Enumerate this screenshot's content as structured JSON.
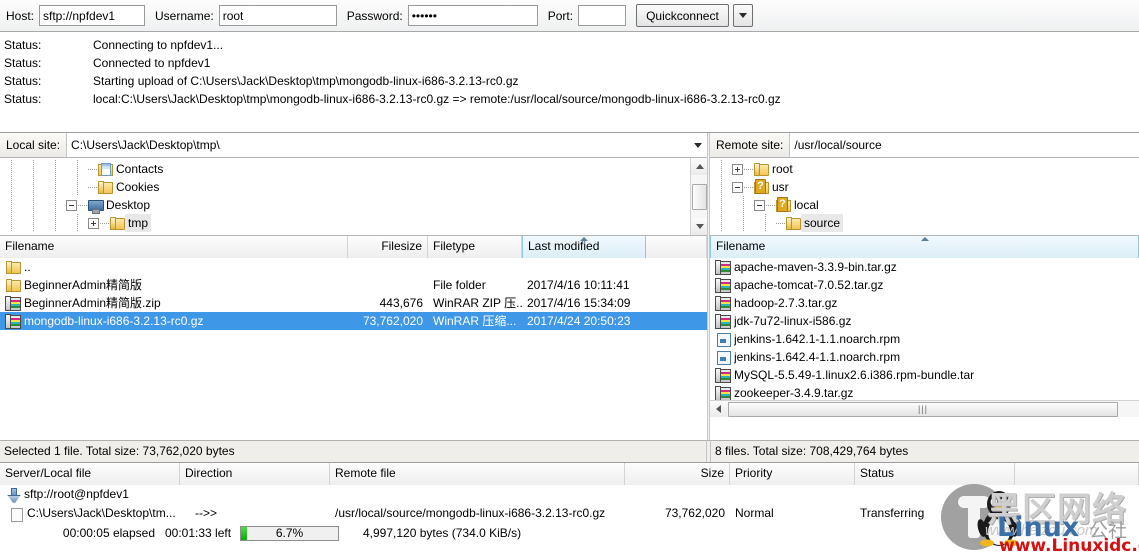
{
  "quickconnect": {
    "host_label": "Host:",
    "host_value": "sftp://npfdev1",
    "user_label": "Username:",
    "user_value": "root",
    "pass_label": "Password:",
    "pass_value": "••••••",
    "port_label": "Port:",
    "port_value": "",
    "port_placeholder": "",
    "connect_label": "Quickconnect",
    "dropdown_icon": "chevron-down-icon"
  },
  "log": {
    "key": "Status:",
    "messages": [
      "Connecting to npfdev1...",
      "Connected to npfdev1",
      "Starting upload of C:\\Users\\Jack\\Desktop\\tmp\\mongodb-linux-i686-3.2.13-rc0.gz",
      "local:C:\\Users\\Jack\\Desktop\\tmp\\mongodb-linux-i686-3.2.13-rc0.gz => remote:/usr/local/source/mongodb-linux-i686-3.2.13-rc0.gz"
    ]
  },
  "local_pane": {
    "site_label": "Local site:",
    "site_path": "C:\\Users\\Jack\\Desktop\\tmp\\",
    "tree": [
      {
        "label": "Contacts",
        "depth": 4,
        "expander": "none",
        "icon": "folder-contacts-icon",
        "selected": false
      },
      {
        "label": "Cookies",
        "depth": 4,
        "expander": "none",
        "icon": "folder-icon",
        "selected": false
      },
      {
        "label": "Desktop",
        "depth": 3,
        "expander": "minus",
        "icon": "desktop-icon",
        "selected": false
      },
      {
        "label": "tmp",
        "depth": 4,
        "expander": "plus",
        "icon": "folder-icon",
        "selected": true
      }
    ],
    "columns": [
      "Filename",
      "Filesize",
      "Filetype",
      "Last modified"
    ],
    "sorted_column": "Last modified",
    "sort_direction": "asc",
    "files": [
      {
        "name": "..",
        "size": "",
        "type": "",
        "modified": "",
        "icon": "folder-up-icon",
        "selected": false
      },
      {
        "name": "BeginnerAdmin精简版",
        "size": "",
        "type": "File folder",
        "modified": "2017/4/16 10:11:41",
        "icon": "folder-icon",
        "selected": false
      },
      {
        "name": "BeginnerAdmin精简版.zip",
        "size": "443,676",
        "type": "WinRAR ZIP 压...",
        "modified": "2017/4/16 15:34:09",
        "icon": "archive-icon",
        "selected": false
      },
      {
        "name": "mongodb-linux-i686-3.2.13-rc0.gz",
        "size": "73,762,020",
        "type": "WinRAR 压缩...",
        "modified": "2017/4/24 20:50:23",
        "icon": "archive-icon",
        "selected": true
      }
    ],
    "status": "Selected 1 file. Total size: 73,762,020 bytes"
  },
  "remote_pane": {
    "site_label": "Remote site:",
    "site_path": "/usr/local/source",
    "tree": [
      {
        "label": "root",
        "depth": 1,
        "expander": "plus",
        "icon": "folder-icon",
        "selected": false
      },
      {
        "label": "usr",
        "depth": 1,
        "expander": "minus",
        "icon": "folder-unknown-icon",
        "selected": false
      },
      {
        "label": "local",
        "depth": 2,
        "expander": "minus",
        "icon": "folder-unknown-icon",
        "selected": false
      },
      {
        "label": "source",
        "depth": 3,
        "expander": "none",
        "icon": "folder-icon",
        "selected": true
      }
    ],
    "columns": [
      "Filename"
    ],
    "sorted_column": "Filename",
    "sort_direction": "asc",
    "files": [
      {
        "name": "apache-maven-3.3.9-bin.tar.gz",
        "icon": "archive-icon"
      },
      {
        "name": "apache-tomcat-7.0.52.tar.gz",
        "icon": "archive-icon"
      },
      {
        "name": "hadoop-2.7.3.tar.gz",
        "icon": "archive-icon"
      },
      {
        "name": "jdk-7u72-linux-i586.gz",
        "icon": "archive-icon"
      },
      {
        "name": "jenkins-1.642.1-1.1.noarch.rpm",
        "icon": "rpm-icon"
      },
      {
        "name": "jenkins-1.642.4-1.1.noarch.rpm",
        "icon": "rpm-icon"
      },
      {
        "name": "MySQL-5.5.49-1.linux2.6.i386.rpm-bundle.tar",
        "icon": "archive-icon"
      },
      {
        "name": "zookeeper-3.4.9.tar.gz",
        "icon": "archive-icon"
      }
    ],
    "status": "8 files. Total size: 708,429,764 bytes"
  },
  "queue": {
    "columns": [
      "Server/Local file",
      "Direction",
      "Remote file",
      "Size",
      "Priority",
      "Status"
    ],
    "server_row": {
      "label": "sftp://root@npfdev1",
      "icon": "server-icon"
    },
    "transfer_row": {
      "local_file": "C:\\Users\\Jack\\Desktop\\tm...",
      "direction": "-->>",
      "remote_file": "/usr/local/source/mongodb-linux-i686-3.2.13-rc0.gz",
      "size": "73,762,020",
      "priority": "Normal",
      "status": "Transferring",
      "icon": "file-icon"
    },
    "progress": {
      "elapsed": "00:00:05 elapsed",
      "left": "00:01:33 left",
      "percent_label": "6.7%",
      "percent_value": 6.7,
      "bytes": "4,997,120 bytes (734.0 KiB/s)"
    }
  },
  "watermark": {
    "cn_title": "黑区网络",
    "brand": "Linux",
    "brand_suffix": "公社",
    "url": "www.Linuxidc.com",
    "faint": "www.heizou.com"
  },
  "colors": {
    "selection": "#3f97e8",
    "progress_green": "#0aa80a",
    "sorted_header": "#dceef8",
    "watermark_blue": "#3b6fa8",
    "watermark_red": "#d51010"
  }
}
